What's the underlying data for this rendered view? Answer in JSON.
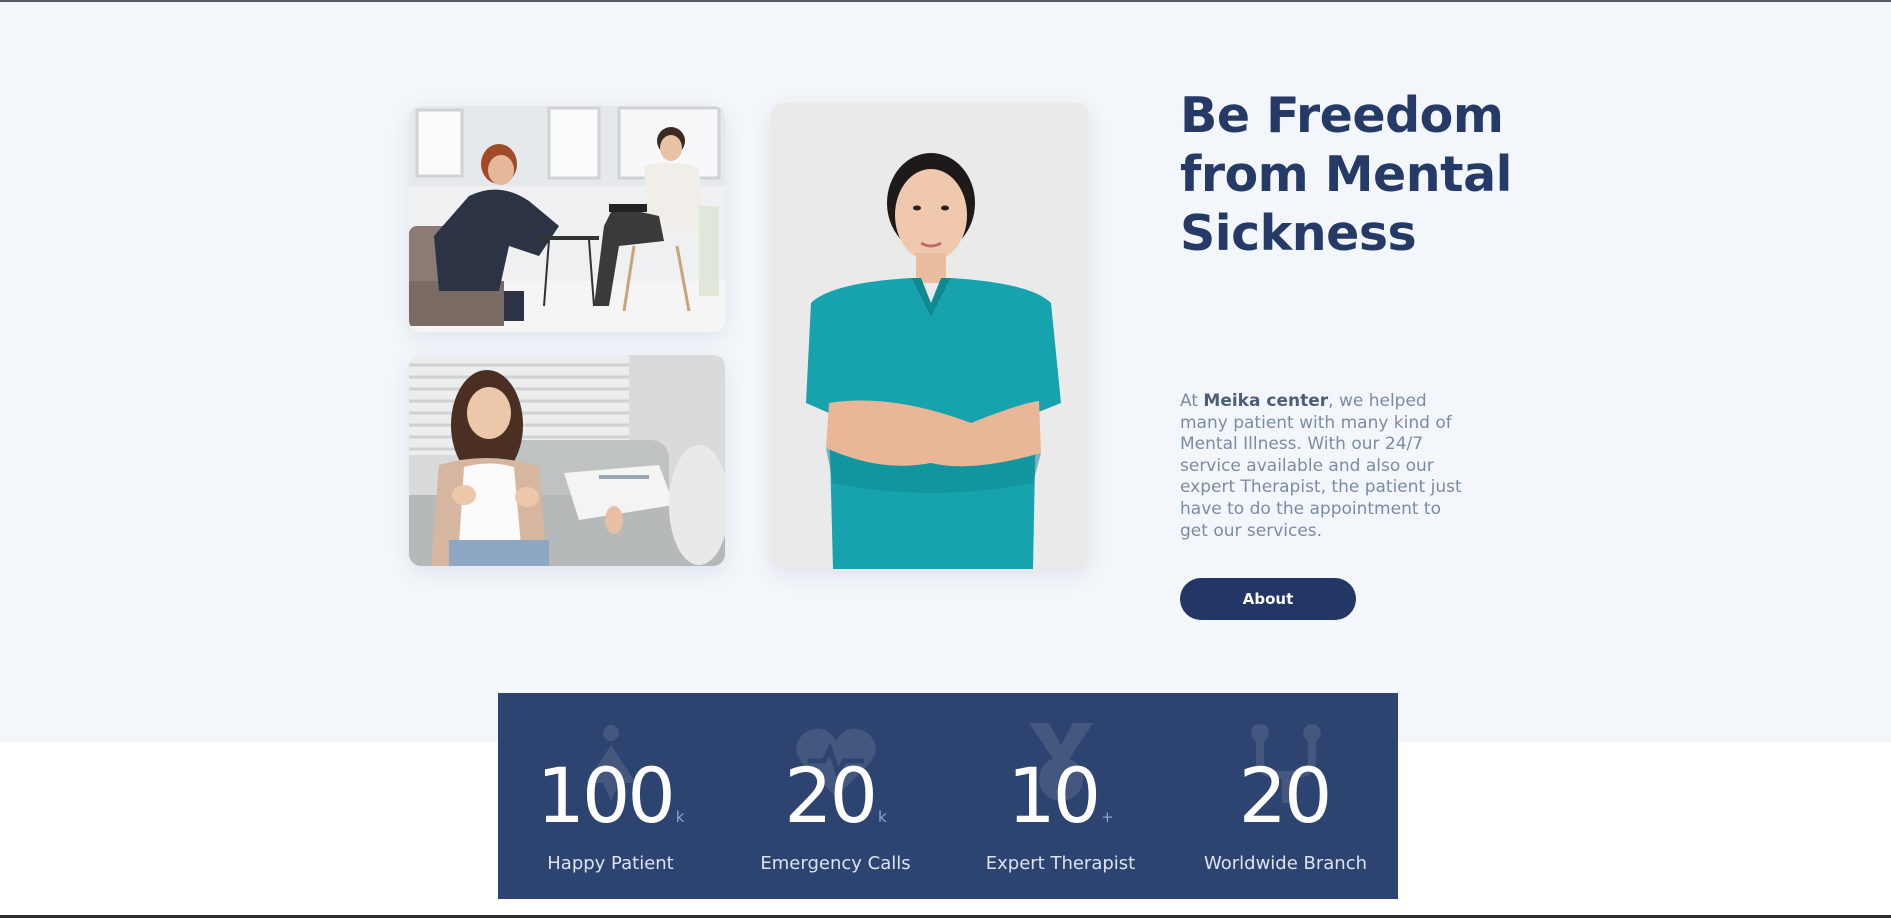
{
  "hero": {
    "headline": "Be Freedom from Mental Sickness",
    "description_prefix": "At ",
    "description_brand": "Meika center",
    "description_rest": ", we helped many patient with many kind of Mental Illness. With our 24/7 service available and also our expert Therapist, the patient just have to do the appointment to get our services.",
    "about_button": "About"
  },
  "images": [
    {
      "name": "therapy-session-photo",
      "depicts": "patient talking with therapist taking notes"
    },
    {
      "name": "patient-talking-photo",
      "depicts": "smiling woman on couch talking to therapist"
    },
    {
      "name": "therapist-portrait-photo",
      "depicts": "therapist in teal scrubs with arms crossed"
    }
  ],
  "stats": [
    {
      "number": "100",
      "suffix": "k",
      "label": "Happy Patient",
      "icon": "person-icon"
    },
    {
      "number": "20",
      "suffix": "k",
      "label": "Emergency Calls",
      "icon": "heartbeat-icon"
    },
    {
      "number": "10",
      "suffix": "+",
      "label": "Expert Therapist",
      "icon": "medal-icon"
    },
    {
      "number": "20",
      "suffix": "",
      "label": "Worldwide Branch",
      "icon": "network-icon"
    }
  ],
  "colors": {
    "hero_background": "#f3f7fb",
    "navy": "#253a66",
    "stats_background": "#2d4470",
    "text_muted": "#7c8ba5"
  }
}
